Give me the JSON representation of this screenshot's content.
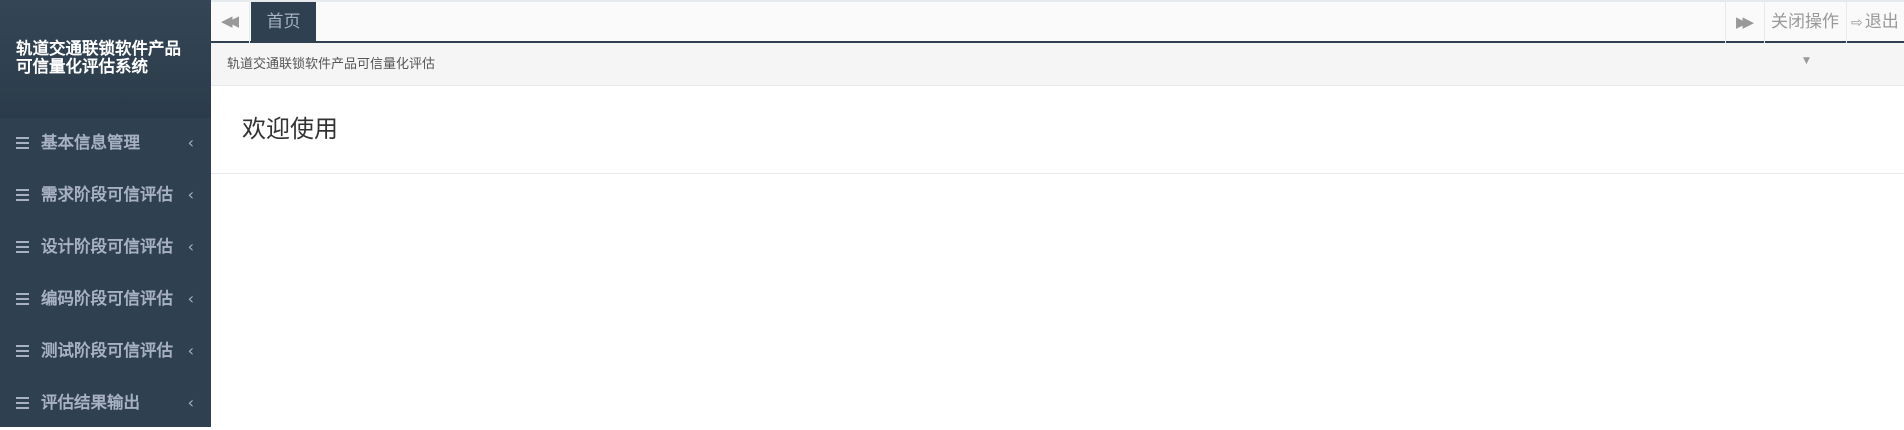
{
  "brand": {
    "title": "轨道交通联锁软件产品\n可信量化评估系统"
  },
  "sidebar": {
    "items": [
      {
        "label": "基本信息管理"
      },
      {
        "label": "需求阶段可信评估"
      },
      {
        "label": "设计阶段可信评估"
      },
      {
        "label": "编码阶段可信评估"
      },
      {
        "label": "测试阶段可信评估"
      },
      {
        "label": "评估结果输出"
      }
    ],
    "item_icon": "bars-icon",
    "chevron_icon": "chevron-left-icon"
  },
  "tabs": {
    "prev_icon": "double-left-icon",
    "active_tab": "首页",
    "next_icon": "double-right-icon",
    "close_ops_label": "关闭操作",
    "exit_label": "退出",
    "exit_icon": "sign-out-icon"
  },
  "subbar": {
    "breadcrumb": "轨道交通联锁软件产品可信量化评估",
    "dropdown_icon": "caret-down-icon"
  },
  "main": {
    "welcome": "欢迎使用"
  },
  "colors": {
    "sidebar_bg": "#2f4050",
    "sidebar_text": "#a7b1c2",
    "tab_active_bg": "#2f4050"
  }
}
